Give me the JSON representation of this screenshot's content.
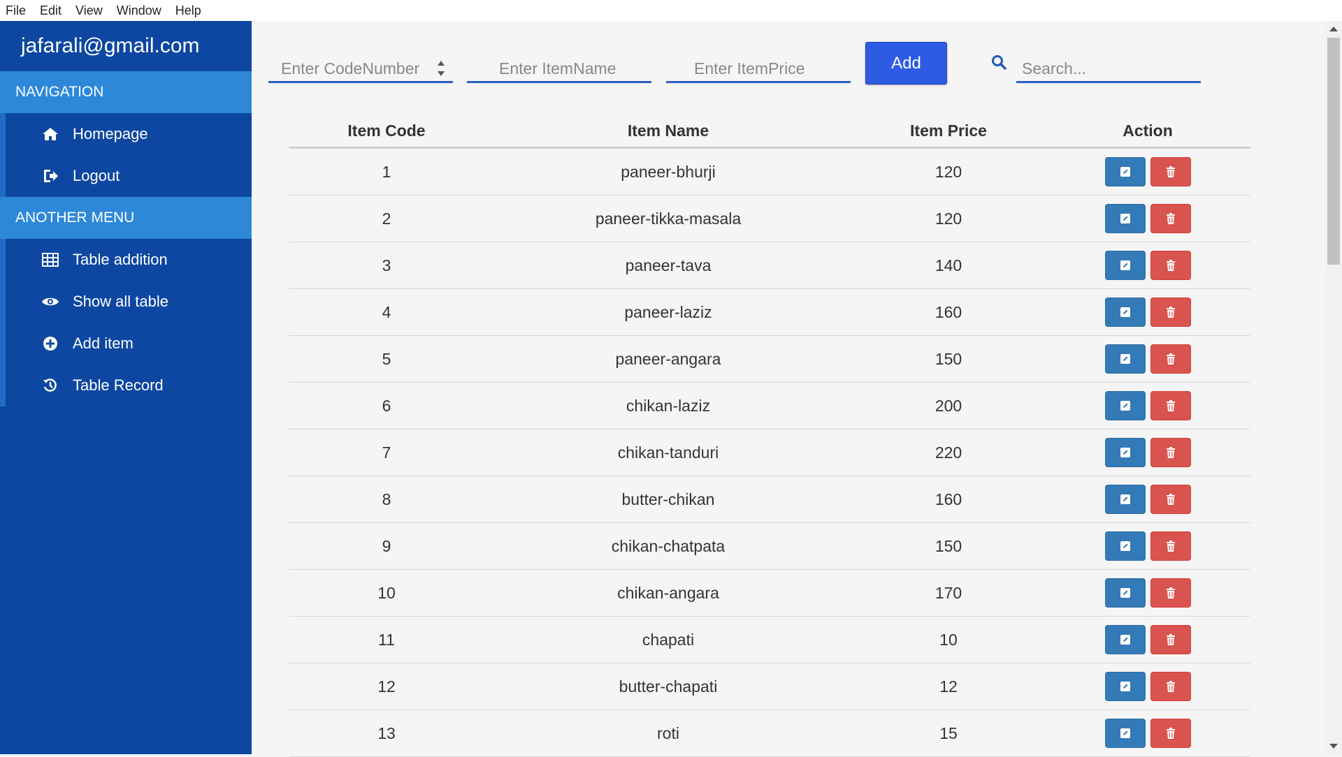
{
  "menubar": {
    "items": [
      "File",
      "Edit",
      "View",
      "Window",
      "Help"
    ]
  },
  "sidebar": {
    "user_email": "jafarali@gmail.com",
    "sections": [
      {
        "title": "NAVIGATION",
        "items": [
          {
            "label": "Homepage",
            "icon": "home-icon"
          },
          {
            "label": "Logout",
            "icon": "logout-icon"
          }
        ]
      },
      {
        "title": "ANOTHER MENU",
        "items": [
          {
            "label": "Table addition",
            "icon": "table-icon"
          },
          {
            "label": "Show all table",
            "icon": "eye-icon"
          },
          {
            "label": "Add item",
            "icon": "plus-circle-icon"
          },
          {
            "label": "Table Record",
            "icon": "history-icon"
          }
        ]
      }
    ],
    "colors": {
      "background": "#0d47a1",
      "section_header": "#2e88d9"
    }
  },
  "form": {
    "code_placeholder": "Enter CodeNumber",
    "code_value": "",
    "name_placeholder": "Enter ItemName",
    "name_value": "",
    "price_placeholder": "Enter ItemPrice",
    "price_value": "",
    "add_label": "Add",
    "search_placeholder": "Search...",
    "search_value": ""
  },
  "table": {
    "headers": {
      "code": "Item Code",
      "name": "Item Name",
      "price": "Item Price",
      "action": "Action"
    },
    "rows": [
      {
        "code": "1",
        "name": "paneer-bhurji",
        "price": "120"
      },
      {
        "code": "2",
        "name": "paneer-tikka-masala",
        "price": "120"
      },
      {
        "code": "3",
        "name": "paneer-tava",
        "price": "140"
      },
      {
        "code": "4",
        "name": "paneer-laziz",
        "price": "160"
      },
      {
        "code": "5",
        "name": "paneer-angara",
        "price": "150"
      },
      {
        "code": "6",
        "name": "chikan-laziz",
        "price": "200"
      },
      {
        "code": "7",
        "name": "chikan-tanduri",
        "price": "220"
      },
      {
        "code": "8",
        "name": "butter-chikan",
        "price": "160"
      },
      {
        "code": "9",
        "name": "chikan-chatpata",
        "price": "150"
      },
      {
        "code": "10",
        "name": "chikan-angara",
        "price": "170"
      },
      {
        "code": "11",
        "name": "chapati",
        "price": "10"
      },
      {
        "code": "12",
        "name": "butter-chapati",
        "price": "12"
      },
      {
        "code": "13",
        "name": "roti",
        "price": "15"
      }
    ],
    "row_actions": [
      {
        "icon": "edit-icon",
        "color": "#337ab7"
      },
      {
        "icon": "trash-icon",
        "color": "#d9534f"
      }
    ]
  },
  "colors": {
    "add_button": "#2d5be3",
    "input_underline": "#2a5fc4"
  }
}
